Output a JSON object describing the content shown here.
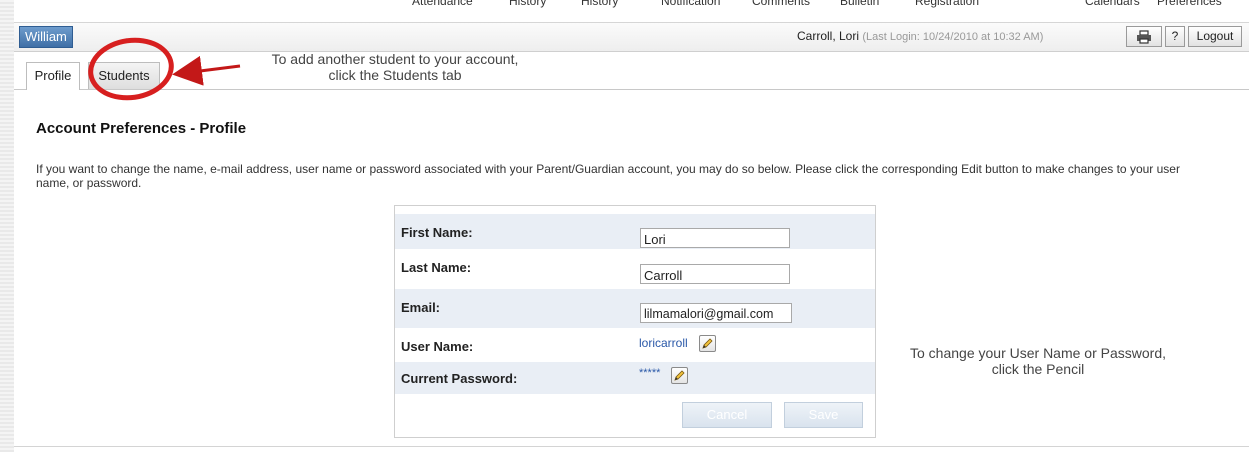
{
  "topnav": [
    "Attendance",
    "History",
    "History",
    "Notification",
    "Comments",
    "Bulletin",
    "Registration",
    "Calendars",
    "Preferences"
  ],
  "header": {
    "student": "William",
    "account_name": "Carroll, Lori",
    "last_login": "(Last Login: 10/24/2010 at 10:32 AM)",
    "help_label": "?",
    "logout_label": "Logout"
  },
  "tabs": [
    {
      "label": "Profile",
      "active": true
    },
    {
      "label": "Students",
      "active": false
    }
  ],
  "callouts": {
    "students_line1": "To add another student to your account,",
    "students_line2": "click the Students tab",
    "pencil_line1": "To change your User Name or Password,",
    "pencil_line2": "click the Pencil"
  },
  "page_title": "Account Preferences - Profile",
  "intro": "If you want to change the name, e-mail address, user name or password associated with your Parent/Guardian account, you may do so below. Please click the corresponding Edit button to make changes to your user name, or password.",
  "form": {
    "first_name_label": "First Name:",
    "first_name": "Lori",
    "last_name_label": "Last Name:",
    "last_name": "Carroll",
    "email_label": "Email:",
    "email": "lilmamalori@gmail.com",
    "username_label": "User Name:",
    "username": "loricarroll",
    "password_label": "Current Password:",
    "password": "*****",
    "cancel_label": "Cancel",
    "save_label": "Save"
  },
  "colors": {
    "annotation_red": "#d71f1f",
    "link_blue": "#2a58a8",
    "row_shade": "#e9eef5",
    "student_chip": "#4f7fb8"
  },
  "icons": [
    "print-icon",
    "pencil-icon",
    "arrow-icon"
  ]
}
